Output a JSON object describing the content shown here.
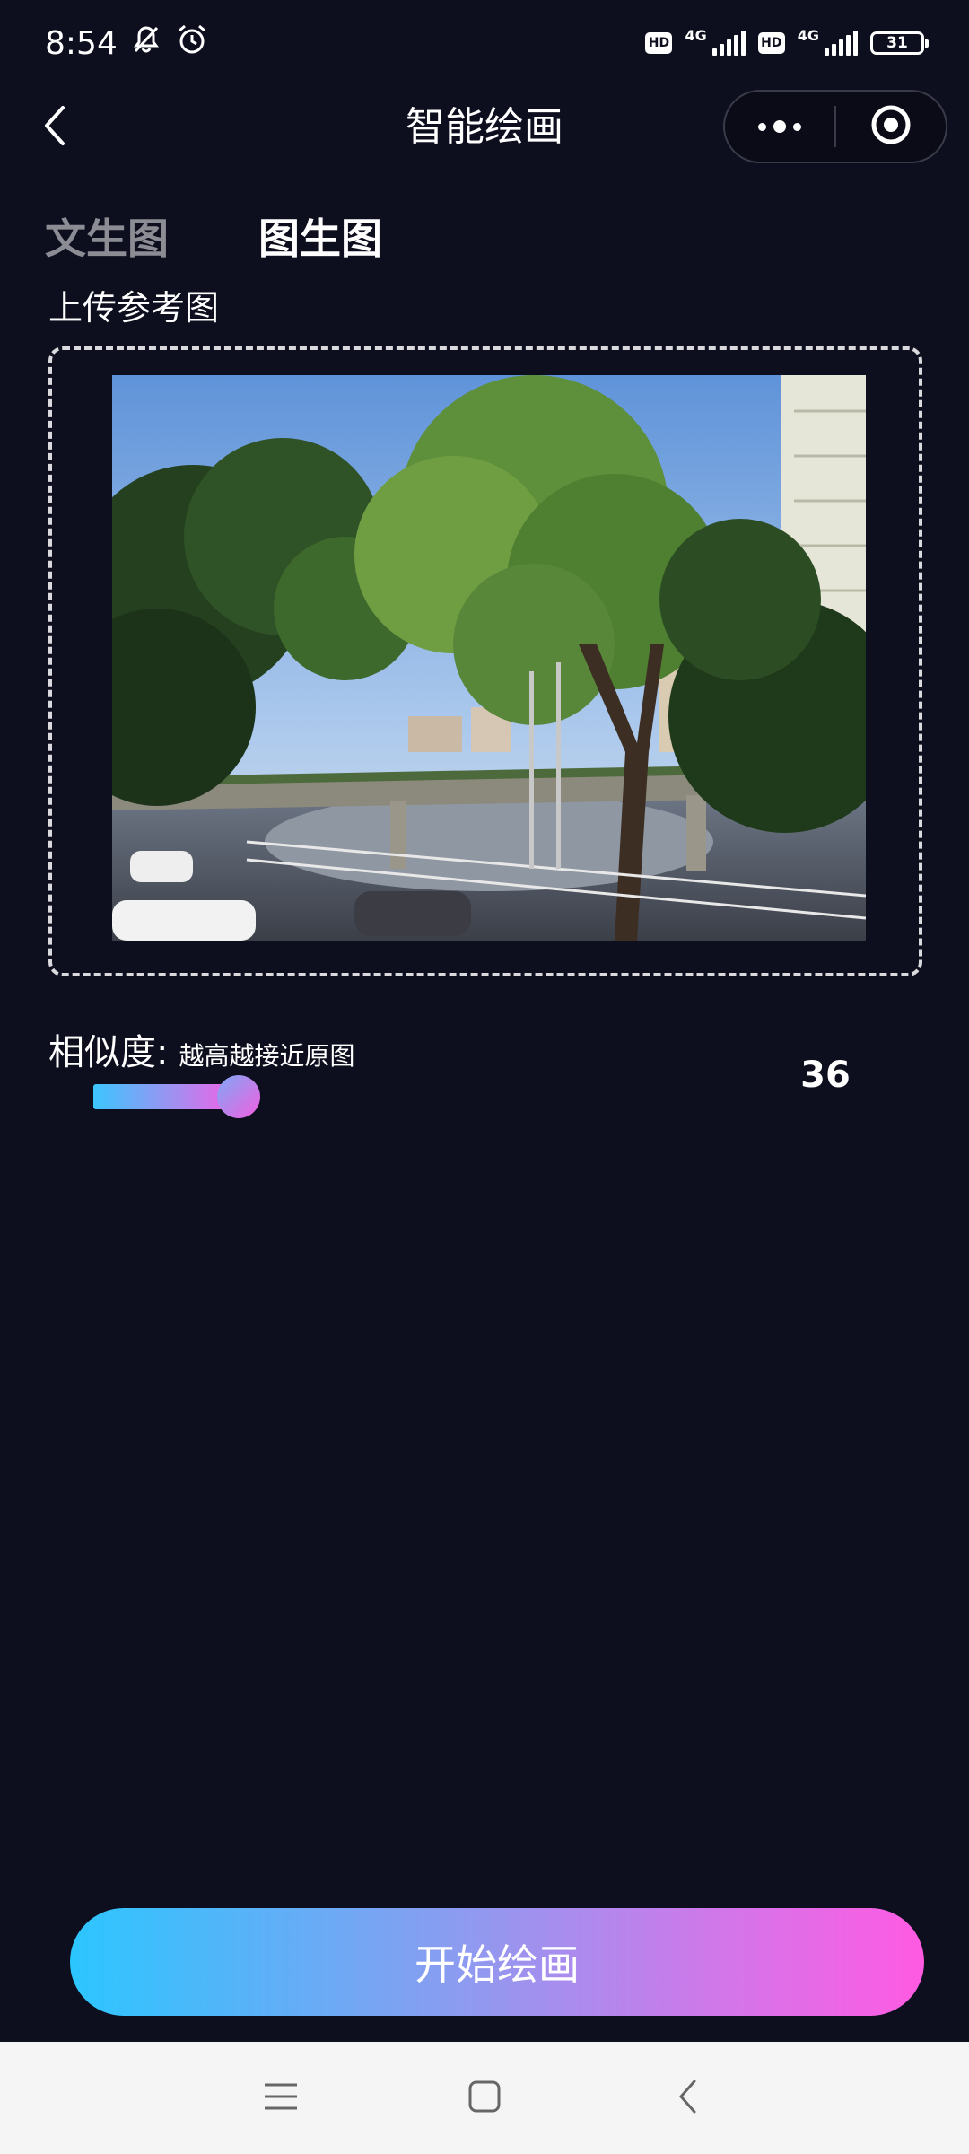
{
  "status_bar": {
    "time": "8:54",
    "icons": [
      "bell-off-icon",
      "alarm-icon",
      "hd-icon",
      "signal-4g-icon",
      "hd-icon",
      "signal-4g-icon",
      "battery-icon"
    ],
    "network_1": "4G",
    "network_2": "4G",
    "hd_label": "HD",
    "battery_level": "31"
  },
  "header": {
    "title": "智能绘画",
    "back_icon": "chevron-left-icon",
    "more_icon": "more-dots-icon",
    "close_icon": "target-circle-icon"
  },
  "tabs": [
    {
      "label": "文生图",
      "active": false
    },
    {
      "label": "图生图",
      "active": true
    }
  ],
  "upload": {
    "label": "上传参考图"
  },
  "similarity": {
    "label": "相似度:",
    "hint": "越高越接近原图",
    "value": "36",
    "fill_fraction": 0.58
  },
  "start_button": {
    "label": "开始绘画"
  },
  "colors": {
    "background": "#0e0f1e",
    "gradient_start": "#2cc6ff",
    "gradient_end": "#ff5ae2",
    "inactive_tab": "#8b8c94"
  },
  "system_nav": {
    "icons": [
      "menu-icon",
      "home-square-icon",
      "back-icon"
    ]
  }
}
